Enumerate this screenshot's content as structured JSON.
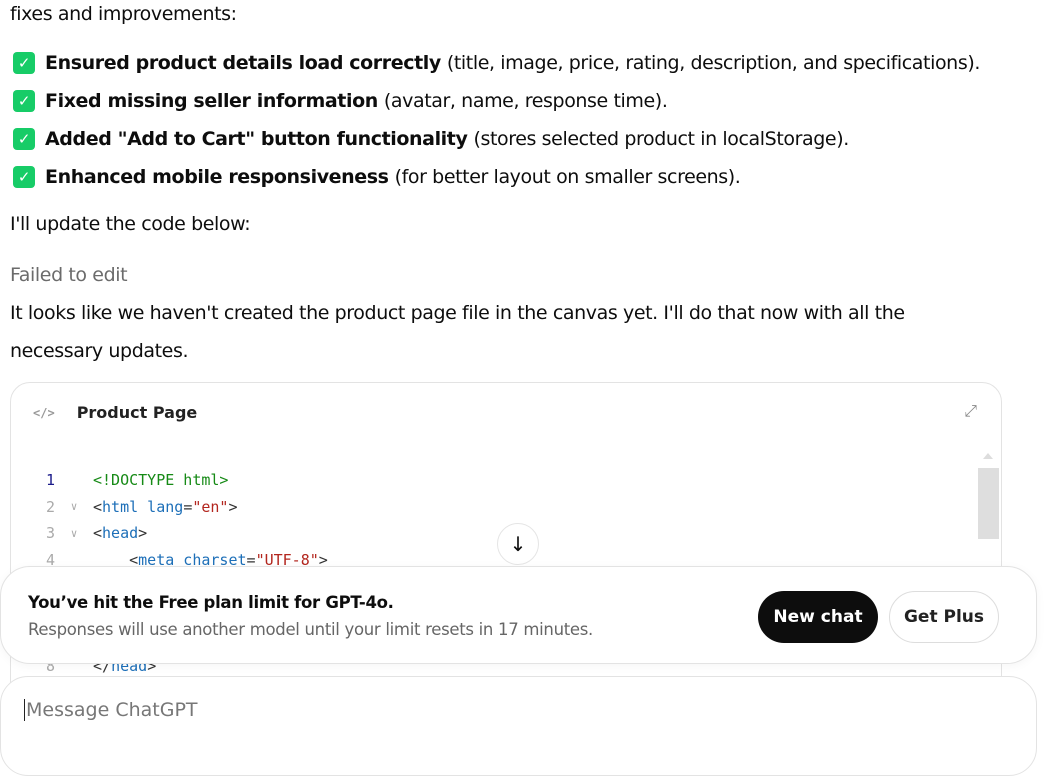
{
  "intro": "fixes and improvements:",
  "items": [
    {
      "bold": "Ensured product details load correctly",
      "rest": "(title, image, price, rating, description, and specifications)."
    },
    {
      "bold": "Fixed missing seller information",
      "rest": "(avatar, name, response time)."
    },
    {
      "bold": "Added \"Add to Cart\" button functionality",
      "rest": "(stores selected product in localStorage)."
    },
    {
      "bold": "Enhanced mobile responsiveness",
      "rest": "(for better layout on smaller screens)."
    }
  ],
  "update": "I'll update the code below:",
  "failed": "Failed to edit",
  "para1": "It looks like we haven't created the product page file in the canvas yet. I'll do that now with all the",
  "para2": "necessary updates.",
  "card": {
    "title": "Product Page",
    "lines": [
      {
        "n": "1",
        "t1": "<!DOCTYPE html>"
      },
      {
        "n": "2",
        "a": "<",
        "b": "html lang",
        "c": "=",
        "d": "\"en\"",
        "e": ">"
      },
      {
        "n": "3",
        "a": "<",
        "b": "head",
        "e": ">"
      },
      {
        "n": "4",
        "a": "    <",
        "b": "meta charset",
        "c": "=",
        "d": "\"UTF-8\"",
        "e": ">"
      },
      {
        "n": "8",
        "a": "</",
        "b": "head",
        "e": ">"
      }
    ]
  },
  "banner": {
    "title": "You’ve hit the Free plan limit for GPT-4o.",
    "subtitle": "Responses will use another model until your limit resets in 17 minutes.",
    "new_chat": "New chat",
    "get_plus": "Get Plus"
  },
  "composer": {
    "placeholder": "Message ChatGPT"
  }
}
